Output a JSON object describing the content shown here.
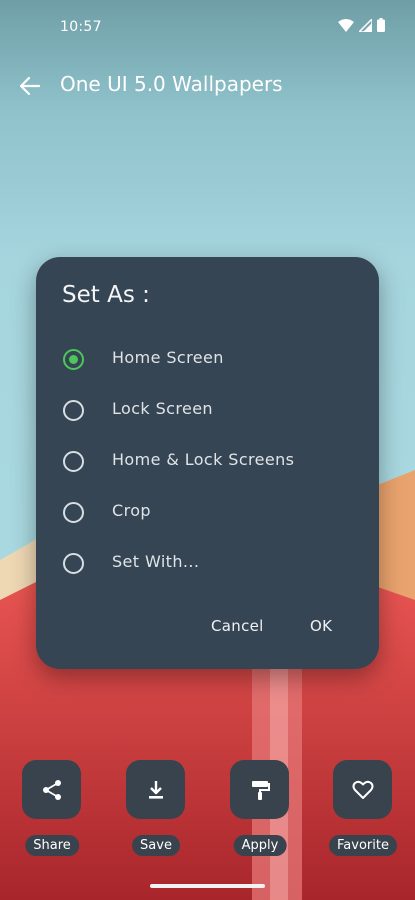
{
  "status_bar": {
    "time": "10:57"
  },
  "app_bar": {
    "title": "One UI 5.0 Wallpapers"
  },
  "dialog": {
    "title": "Set As :",
    "options": [
      {
        "label": "Home Screen",
        "checked": true
      },
      {
        "label": "Lock Screen",
        "checked": false
      },
      {
        "label": "Home & Lock Screens",
        "checked": false
      },
      {
        "label": "Crop",
        "checked": false
      },
      {
        "label": "Set With...",
        "checked": false
      }
    ],
    "cancel_label": "Cancel",
    "ok_label": "OK"
  },
  "actions": [
    {
      "label": "Share",
      "icon": "share-icon"
    },
    {
      "label": "Save",
      "icon": "download-icon"
    },
    {
      "label": "Apply",
      "icon": "paint-roller-icon"
    },
    {
      "label": "Favorite",
      "icon": "heart-icon"
    }
  ],
  "colors": {
    "dialog_bg": "#364553",
    "radio_checked": "#4cc75a",
    "action_tile": "#39434d"
  }
}
